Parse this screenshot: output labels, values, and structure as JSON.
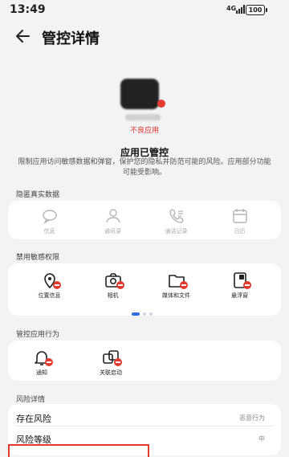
{
  "status": {
    "time": "13:49",
    "signal": "4G",
    "battery": "100"
  },
  "header": {
    "title": "管控详情"
  },
  "app": {
    "badge_text": "不良应用"
  },
  "controlled_title": "应用已管控",
  "description": "限制应用访问敏感数据和弹窗，保护您的隐私并防范可能的风险。应用部分功能可能受影响。",
  "sections": {
    "hidden_data": {
      "label": "隐匿真实数据",
      "items": [
        {
          "label": "信息",
          "icon": "message-icon"
        },
        {
          "label": "通讯录",
          "icon": "contacts-icon"
        },
        {
          "label": "通话记录",
          "icon": "call-log-icon"
        },
        {
          "label": "日历",
          "icon": "calendar-icon"
        }
      ]
    },
    "disabled_permissions": {
      "label": "禁用敏感权限",
      "items": [
        {
          "label": "位置信息",
          "icon": "location-icon"
        },
        {
          "label": "相机",
          "icon": "camera-icon"
        },
        {
          "label": "媒体和文件",
          "icon": "folder-icon"
        },
        {
          "label": "悬浮窗",
          "icon": "floating-window-icon"
        }
      ],
      "page_count": 3,
      "current_page": 1
    },
    "controlled_behavior": {
      "label": "管控应用行为",
      "items": [
        {
          "label": "通知",
          "icon": "bell-icon"
        },
        {
          "label": "关联启动",
          "icon": "linked-launch-icon"
        }
      ]
    },
    "risk_details": {
      "label": "风险详情",
      "rows": [
        {
          "key": "存在风险",
          "value": "恶意行为"
        },
        {
          "key": "风险等级",
          "value": "中"
        }
      ]
    }
  },
  "colors": {
    "accent": "#2f6fe4",
    "danger": "#e23b2e",
    "background": "#f1f3f5",
    "card": "#ffffff"
  }
}
